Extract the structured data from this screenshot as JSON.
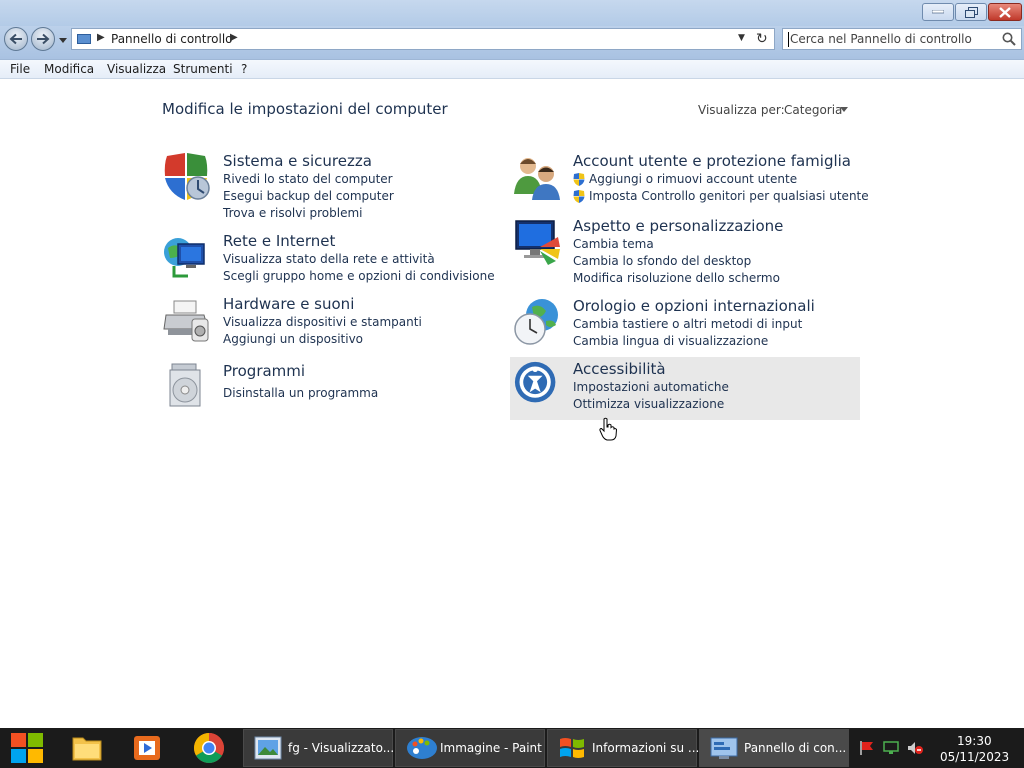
{
  "window": {
    "address_path": "Pannello di controllo",
    "search_placeholder": "Cerca nel Pannello di controllo"
  },
  "menubar": [
    "File",
    "Modifica",
    "Visualizza",
    "Strumenti",
    "?"
  ],
  "main": {
    "title": "Modifica le impostazioni del computer",
    "view_by_label": "Visualizza per:",
    "view_by_value": "Categoria",
    "categories": [
      {
        "title": "Sistema e sicurezza",
        "icon": "shield-icon",
        "links": [
          "Rivedi lo stato del computer",
          "Esegui backup del computer",
          "Trova e risolvi problemi"
        ]
      },
      {
        "title": "Rete e Internet",
        "icon": "network-icon",
        "links": [
          "Visualizza stato della rete e attività",
          "Scegli gruppo home e opzioni di condivisione"
        ]
      },
      {
        "title": "Hardware e suoni",
        "icon": "printer-icon",
        "links": [
          "Visualizza dispositivi e stampanti",
          "Aggiungi un dispositivo"
        ]
      },
      {
        "title": "Programmi",
        "icon": "programs-icon",
        "links": [
          "Disinstalla un programma"
        ]
      },
      {
        "title": "Account utente e protezione famiglia",
        "icon": "users-icon",
        "links": [
          "Aggiungi o rimuovi account utente",
          "Imposta Controllo genitori per qualsiasi utente"
        ]
      },
      {
        "title": "Aspetto e personalizzazione",
        "icon": "monitor-palette-icon",
        "links": [
          "Cambia tema",
          "Cambia lo sfondo del desktop",
          "Modifica risoluzione dello schermo"
        ]
      },
      {
        "title": "Orologio e opzioni internazionali",
        "icon": "clock-globe-icon",
        "links": [
          "Cambia tastiere o altri metodi di input",
          "Cambia lingua di visualizzazione"
        ]
      },
      {
        "title": "Accessibilità",
        "icon": "accessibility-icon",
        "links": [
          "Impostazioni automatiche",
          "Ottimizza visualizzazione"
        ]
      }
    ]
  },
  "taskbar": {
    "tasks": [
      {
        "label": "fg - Visualizzato...",
        "icon": "photo-viewer-icon"
      },
      {
        "label": "Immagine - Paint",
        "icon": "paint-icon"
      },
      {
        "label": "Informazioni su ...",
        "icon": "windows-flag-icon"
      },
      {
        "label": "Pannello di con...",
        "icon": "control-panel-icon"
      }
    ],
    "clock_time": "19:30",
    "clock_date": "05/11/2023"
  }
}
